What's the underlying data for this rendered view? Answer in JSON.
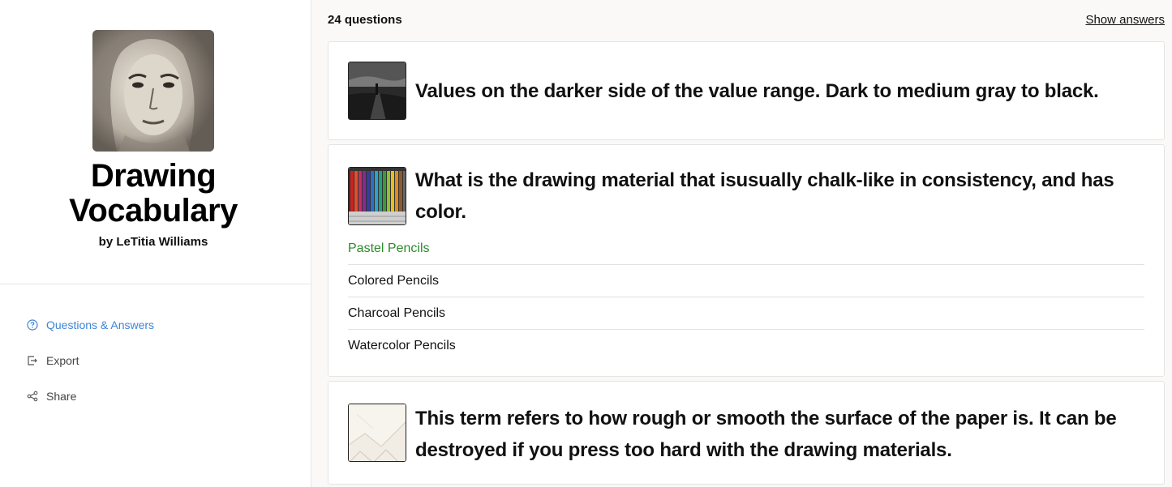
{
  "deck": {
    "title_line1": "Drawing",
    "title_line2": "Vocabulary",
    "author": "by LeTitia Williams"
  },
  "nav": [
    {
      "label": "Questions & Answers",
      "icon": "question-circle-icon",
      "active": true
    },
    {
      "label": "Export",
      "icon": "export-icon",
      "active": false
    },
    {
      "label": "Share",
      "icon": "share-icon",
      "active": false
    }
  ],
  "header": {
    "count": "24 questions",
    "show_answers": "Show answers"
  },
  "questions": [
    {
      "text": "Values on the darker side of the value range. Dark to medium gray to black.",
      "image": "dark-landscape-photo",
      "answers": []
    },
    {
      "text": "What is the drawing material that isusually chalk-like in consistency, and has color.",
      "image": "colored-pencils-photo",
      "answers": [
        {
          "label": "Pastel Pencils",
          "correct": true
        },
        {
          "label": "Colored Pencils",
          "correct": false
        },
        {
          "label": "Charcoal Pencils",
          "correct": false
        },
        {
          "label": "Watercolor Pencils",
          "correct": false
        }
      ]
    },
    {
      "text": "This term refers to how rough or smooth the surface of the paper is. It can be destroyed if you press too hard with the drawing materials.",
      "image": "paper-samples-photo",
      "answers": []
    }
  ],
  "colors": {
    "accent": "#3d85d8",
    "correct": "#2b8a2b",
    "main_bg": "#faf9f8"
  }
}
